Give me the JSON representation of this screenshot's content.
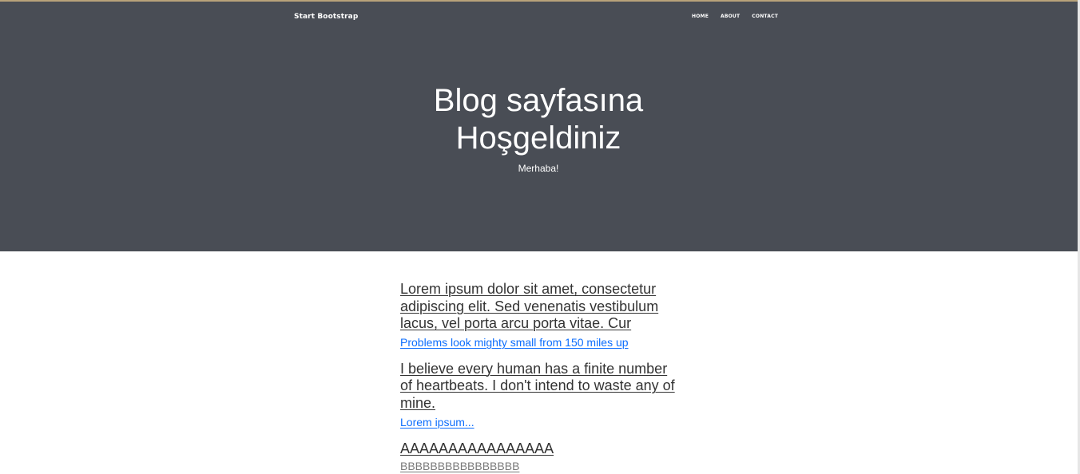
{
  "navbar": {
    "brand": "Start Bootstrap",
    "links": [
      {
        "label": "HOME"
      },
      {
        "label": "ABOUT"
      },
      {
        "label": "CONTACT"
      }
    ]
  },
  "hero": {
    "heading": "Blog sayfasına Hoşgeldiniz",
    "subheading": "Merhaba!"
  },
  "posts": [
    {
      "title": "Lorem ipsum dolor sit amet, consectetur adipiscing elit. Sed venenatis vestibulum lacus, vel porta arcu porta vitae. Cur",
      "subtitle": "Problems look mighty small from 150 miles up"
    },
    {
      "title": "I believe every human has a finite number of heartbeats. I don't intend to waste any of mine.",
      "subtitle": "Lorem ipsum..."
    },
    {
      "title": "AAAAAAAAAAAAAAAA",
      "subtitle": "BBBBBBBBBBBBBBBB"
    }
  ],
  "colors": {
    "hero_background": "#494d55",
    "hero_top_border": "#b8a27a",
    "link_blue": "#0d6efd",
    "post_title": "#333333"
  }
}
